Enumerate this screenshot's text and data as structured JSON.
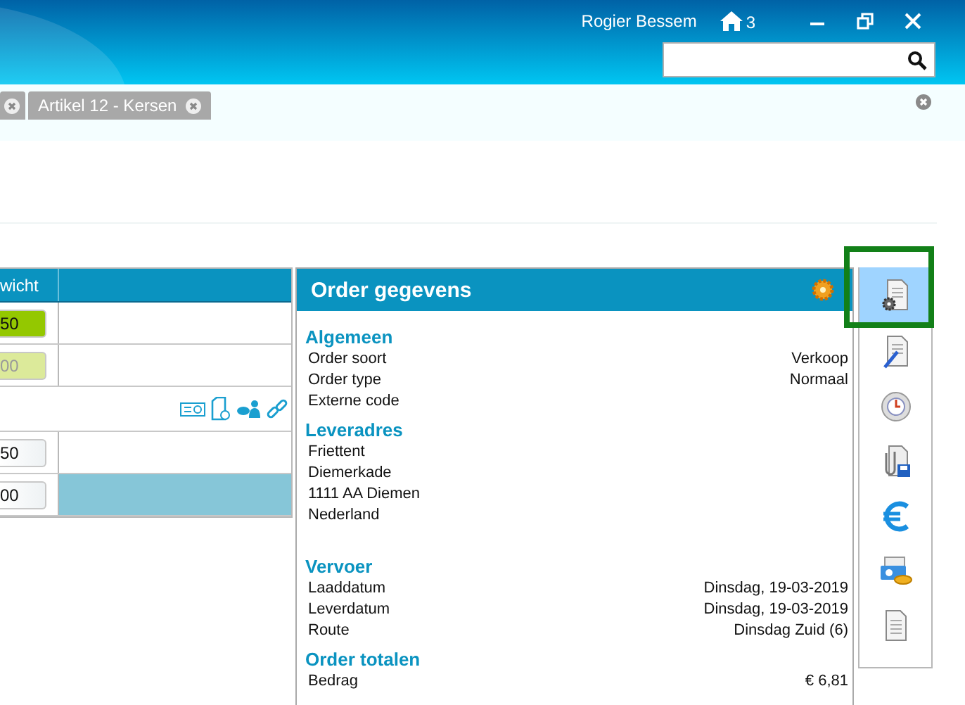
{
  "header": {
    "user_name": "Rogier Bessem",
    "home_count": "3"
  },
  "tabs": [
    {
      "label": "Artikel 12 - Kersen"
    }
  ],
  "table": {
    "columns": [
      "wicht"
    ],
    "rows": [
      {
        "kind": "input",
        "value": "50",
        "highlighted": true,
        "disabled": false,
        "selected": false
      },
      {
        "kind": "input",
        "value": "00",
        "highlighted": true,
        "disabled": true,
        "selected": false
      },
      {
        "kind": "actions"
      },
      {
        "kind": "input",
        "value": "50",
        "highlighted": false,
        "disabled": false,
        "selected": false
      },
      {
        "kind": "input",
        "value": "00",
        "highlighted": false,
        "disabled": false,
        "selected": true
      }
    ]
  },
  "order_panel": {
    "title": "Order gegevens",
    "sections": [
      {
        "kind": "fields",
        "title": "Algemeen",
        "rows": [
          {
            "label": "Order soort",
            "value": "Verkoop"
          },
          {
            "label": "Order type",
            "value": "Normaal"
          },
          {
            "label": "Externe code",
            "value": ""
          }
        ]
      },
      {
        "kind": "address",
        "title": "Leveradres",
        "lines": [
          "Friettent",
          "Diemerkade",
          "1111 AA  Diemen",
          "Nederland"
        ]
      },
      {
        "kind": "fields",
        "title": "Vervoer",
        "rows": [
          {
            "label": "Laaddatum",
            "value": "Dinsdag, 19-03-2019"
          },
          {
            "label": "Leverdatum",
            "value": "Dinsdag, 19-03-2019"
          },
          {
            "label": "Route",
            "value": "Dinsdag Zuid (6)"
          }
        ]
      },
      {
        "kind": "fields",
        "title": "Order totalen",
        "rows": [
          {
            "label": "Bedrag",
            "value": "€ 6,81"
          }
        ]
      }
    ]
  },
  "tools": [
    {
      "kind": "doc-gear",
      "selected": true
    },
    {
      "kind": "doc-pen",
      "selected": false
    },
    {
      "kind": "clock",
      "selected": false
    },
    {
      "kind": "attach",
      "selected": false
    },
    {
      "kind": "euro",
      "selected": false
    },
    {
      "kind": "card",
      "selected": false
    },
    {
      "kind": "doc",
      "selected": false
    }
  ]
}
